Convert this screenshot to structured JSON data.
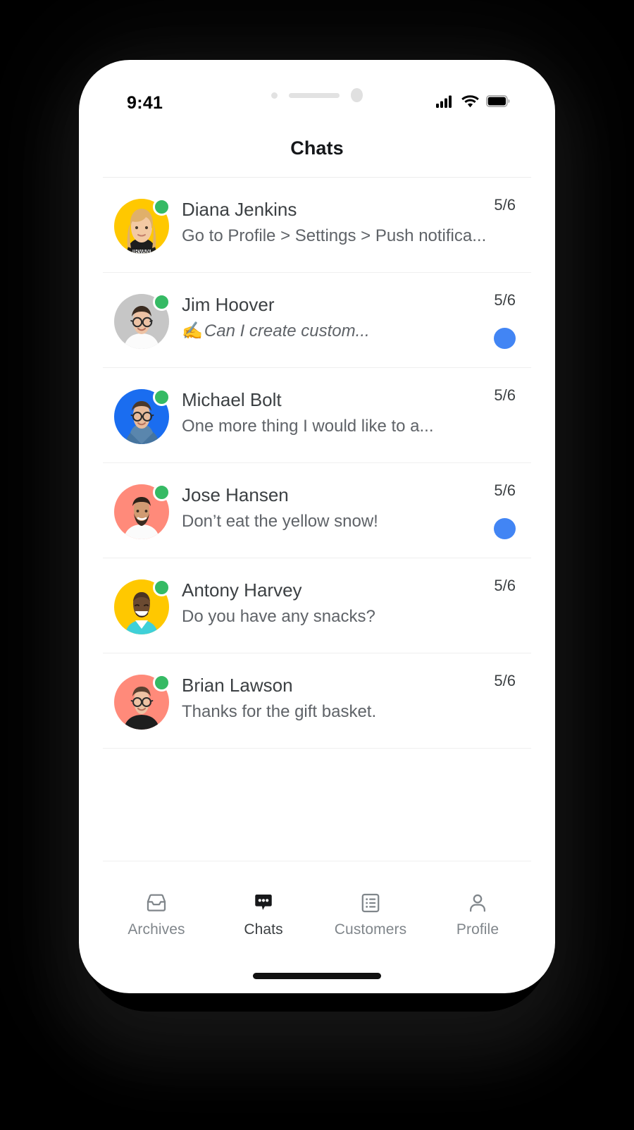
{
  "status_bar": {
    "time": "9:41",
    "icons": [
      "cellular-signal-icon",
      "wifi-icon",
      "battery-icon"
    ]
  },
  "header": {
    "title": "Chats"
  },
  "colors": {
    "accent_unread": "#4285F4",
    "presence_online": "#35BA64",
    "avatar_yellow": "#FFC800",
    "avatar_gray": "#C6C6C6",
    "avatar_blue": "#1A6DF0",
    "avatar_salmon": "#FF8A7A",
    "text_primary": "#3C4043",
    "text_secondary": "#5F6368",
    "divider": "#EFEFEF"
  },
  "chats": [
    {
      "name": "Diana Jenkins",
      "preview": "Go to Profile > Settings > Push notifica...",
      "date": "5/6",
      "online": true,
      "unread": false,
      "draft": false,
      "avatar_bg": "#FFC800",
      "avatar_kind": "photo-woman-blonde"
    },
    {
      "name": "Jim Hoover",
      "preview": "Can I create custom...",
      "preview_emoji": "✍️",
      "date": "5/6",
      "online": true,
      "unread": true,
      "draft": true,
      "avatar_bg": "#C6C6C6",
      "avatar_kind": "photo-man-glasses"
    },
    {
      "name": "Michael Bolt",
      "preview": "One more thing I would like to a...",
      "date": "5/6",
      "online": true,
      "unread": false,
      "draft": false,
      "avatar_bg": "#1A6DF0",
      "avatar_kind": "photo-man-denim"
    },
    {
      "name": "Jose Hansen",
      "preview": "Don’t eat the yellow snow!",
      "date": "5/6",
      "online": true,
      "unread": true,
      "draft": false,
      "avatar_bg": "#FF8A7A",
      "avatar_kind": "photo-man-beard"
    },
    {
      "name": "Antony Harvey",
      "preview": "Do you have any snacks?",
      "date": "5/6",
      "online": true,
      "unread": false,
      "draft": false,
      "avatar_bg": "#FFC800",
      "avatar_kind": "photo-man-smiling"
    },
    {
      "name": "Brian Lawson",
      "preview": "Thanks for the gift basket.",
      "date": "5/6",
      "online": true,
      "unread": false,
      "draft": false,
      "avatar_bg": "#FF8A7A",
      "avatar_kind": "photo-man-glasses-dark"
    }
  ],
  "tabbar": {
    "items": [
      {
        "label": "Archives",
        "icon": "archive-tray-icon",
        "active": false
      },
      {
        "label": "Chats",
        "icon": "chat-bubble-icon",
        "active": true
      },
      {
        "label": "Customers",
        "icon": "list-card-icon",
        "active": false
      },
      {
        "label": "Profile",
        "icon": "person-icon",
        "active": false
      }
    ]
  }
}
